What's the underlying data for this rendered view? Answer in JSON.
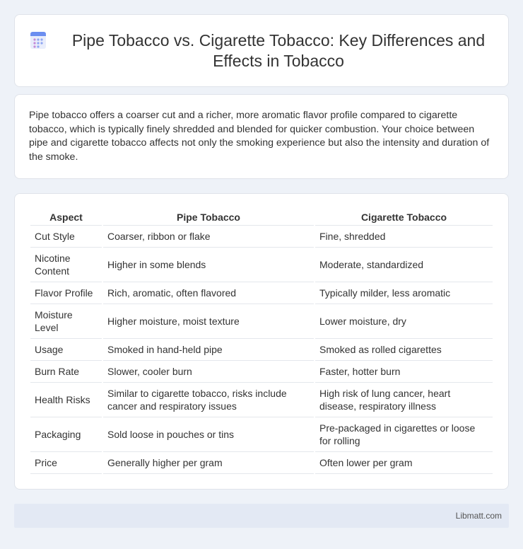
{
  "header": {
    "title": "Pipe Tobacco vs. Cigarette Tobacco: Key Differences and Effects in Tobacco",
    "icon": "document-icon"
  },
  "intro": {
    "text": "Pipe tobacco offers a coarser cut and a richer, more aromatic flavor profile compared to cigarette tobacco, which is typically finely shredded and blended for quicker combustion. Your choice between pipe and cigarette tobacco affects not only the smoking experience but also the intensity and duration of the smoke."
  },
  "table": {
    "headers": [
      "Aspect",
      "Pipe Tobacco",
      "Cigarette Tobacco"
    ],
    "rows": [
      [
        "Cut Style",
        "Coarser, ribbon or flake",
        "Fine, shredded"
      ],
      [
        "Nicotine Content",
        "Higher in some blends",
        "Moderate, standardized"
      ],
      [
        "Flavor Profile",
        "Rich, aromatic, often flavored",
        "Typically milder, less aromatic"
      ],
      [
        "Moisture Level",
        "Higher moisture, moist texture",
        "Lower moisture, dry"
      ],
      [
        "Usage",
        "Smoked in hand-held pipe",
        "Smoked as rolled cigarettes"
      ],
      [
        "Burn Rate",
        "Slower, cooler burn",
        "Faster, hotter burn"
      ],
      [
        "Health Risks",
        "Similar to cigarette tobacco, risks include cancer and respiratory issues",
        "High risk of lung cancer, heart disease, respiratory illness"
      ],
      [
        "Packaging",
        "Sold loose in pouches or tins",
        "Pre-packaged in cigarettes or loose for rolling"
      ],
      [
        "Price",
        "Generally higher per gram",
        "Often lower per gram"
      ]
    ]
  },
  "footer": {
    "brand": "Libmatt.com"
  }
}
